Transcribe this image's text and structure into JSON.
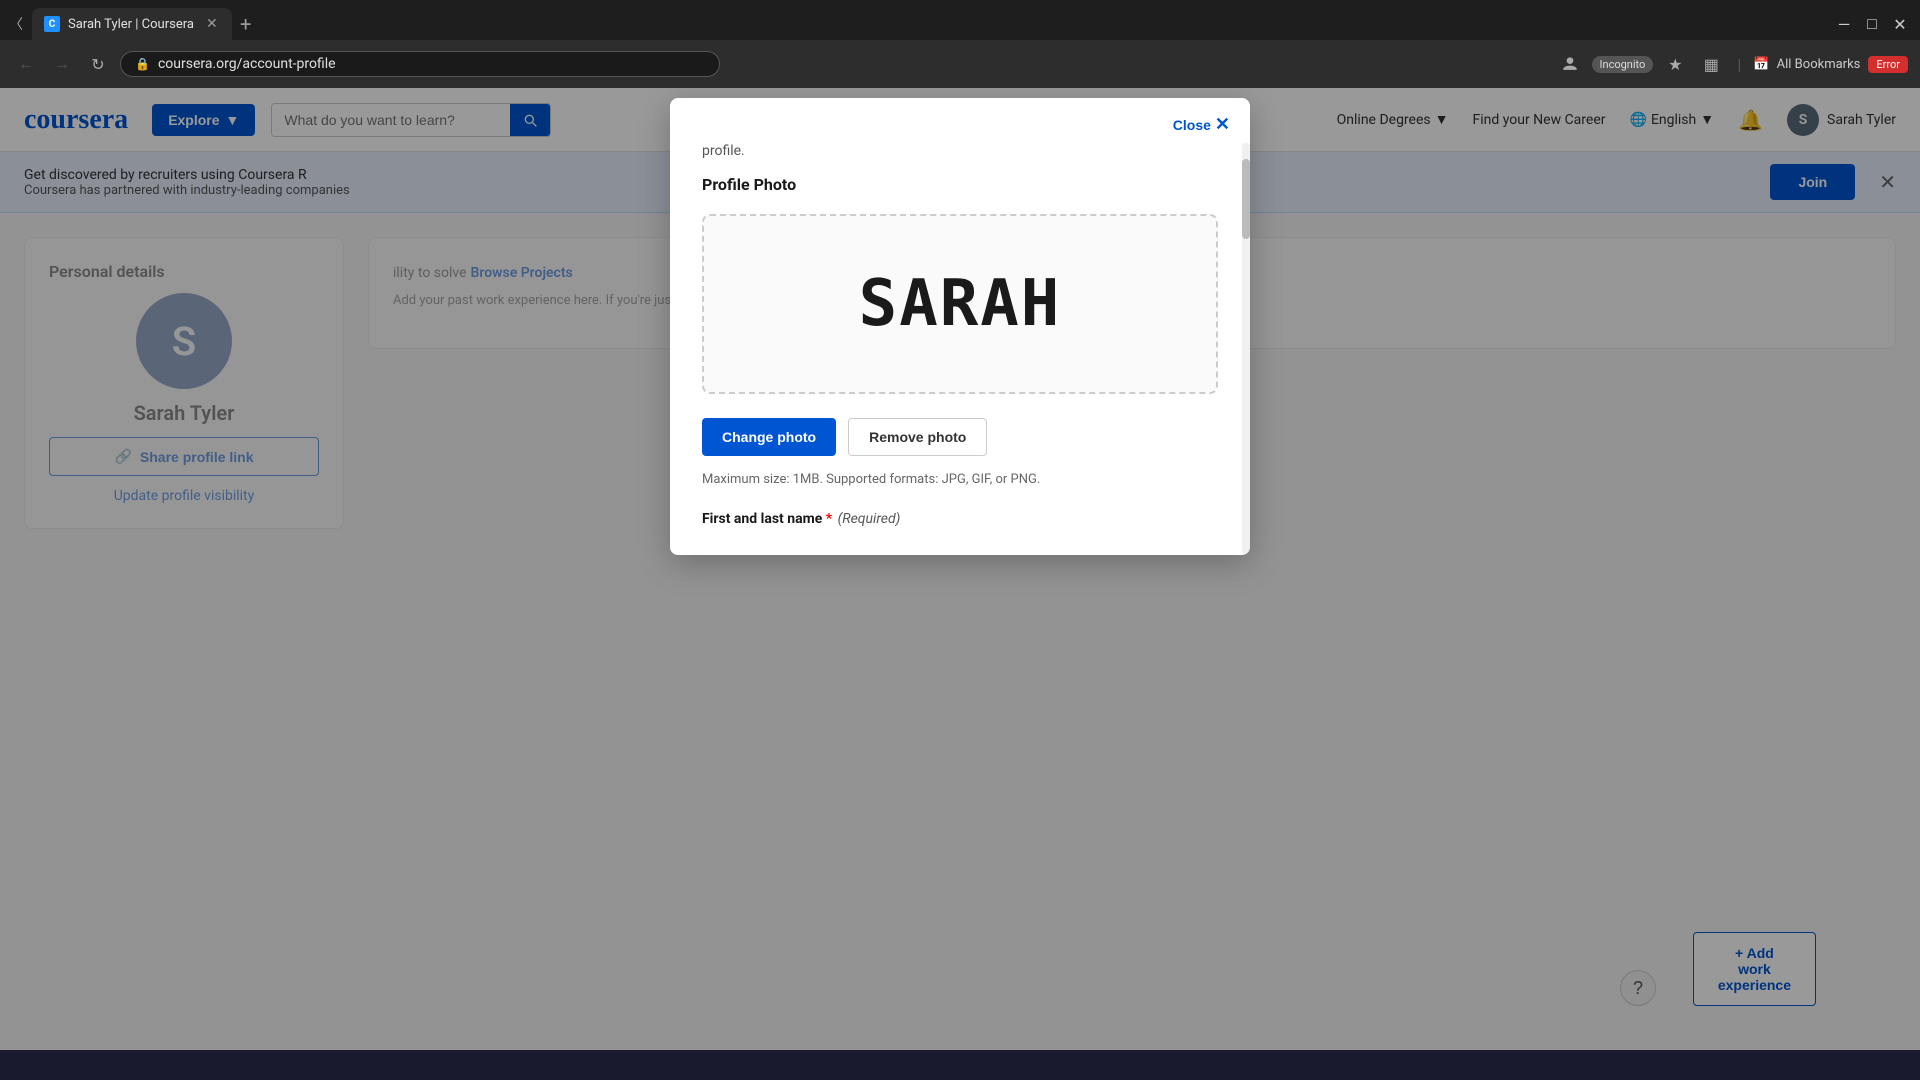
{
  "browser": {
    "tab": {
      "favicon": "C",
      "title": "Sarah Tyler | Coursera"
    },
    "address": "coursera.org/account-profile",
    "toolbar": {
      "incognito_label": "Incognito",
      "error_label": "Error",
      "bookmarks_label": "All Bookmarks"
    }
  },
  "header": {
    "logo": "coursera",
    "explore_label": "Explore",
    "search_placeholder": "What do you want to learn?",
    "nav_items": [
      {
        "label": "Online Degrees",
        "has_dropdown": true
      },
      {
        "label": "Find your New Career",
        "has_dropdown": false
      },
      {
        "label": "English",
        "has_dropdown": true
      }
    ],
    "user_name": "Sarah Tyler",
    "user_initial": "S"
  },
  "promo_bar": {
    "text": "Get discovered by recruiters using Coursera R",
    "subtext": "Coursera has partnered with industry-leading companies",
    "join_label": "Join"
  },
  "sidebar": {
    "personal_details_title": "Personal details",
    "user_name": "Sarah Tyler",
    "user_initial": "S",
    "share_profile_label": "Share profile link",
    "update_visibility_label": "Update profile visibility"
  },
  "main_content": {
    "browse_projects_label": "Browse Projects",
    "ability_text": "ility to solve",
    "add_work_label": "+ Add work experience",
    "help_icon": "?"
  },
  "modal": {
    "close_label": "Close",
    "subtitle": "profile.",
    "section_title": "Profile Photo",
    "photo_text": "SARAH",
    "change_photo_label": "Change photo",
    "remove_photo_label": "Remove photo",
    "photo_hint": "Maximum size: 1MB. Supported formats: JPG, GIF, or PNG.",
    "field_label": "First and last name",
    "required_label": "(Required)",
    "scrollbar": true
  }
}
